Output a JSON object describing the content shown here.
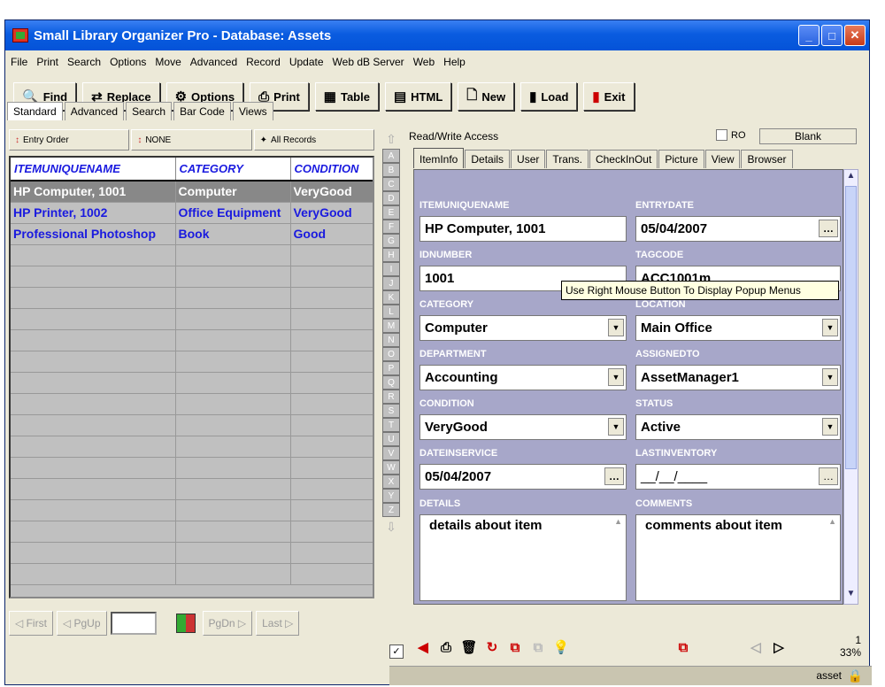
{
  "window": {
    "title": "Small Library Organizer Pro - Database: Assets"
  },
  "menu": [
    "File",
    "Print",
    "Search",
    "Options",
    "Move",
    "Advanced",
    "Record",
    "Update",
    "Web dB Server",
    "Web",
    "Help"
  ],
  "toolbar": {
    "find": "Find",
    "replace": "Replace",
    "options": "Options",
    "print": "Print",
    "table": "Table",
    "html": "HTML",
    "new": "New",
    "load": "Load",
    "exit": "Exit"
  },
  "mode_tabs": [
    "Standard",
    "Advanced",
    "Search",
    "Bar Code",
    "Views"
  ],
  "left_header": {
    "order": "Entry Order",
    "filter": "NONE",
    "records": "All Records"
  },
  "grid": {
    "columns": [
      "ITEMUNIQUENAME",
      "CATEGORY",
      "CONDITION"
    ],
    "rows": [
      [
        "HP Computer, 1001",
        "Computer",
        "VeryGood"
      ],
      [
        "HP Printer, 1002",
        "Office Equipment",
        "VeryGood"
      ],
      [
        "Professional Photoshop",
        "Book",
        "Good"
      ]
    ]
  },
  "left_footer": {
    "first": "First",
    "pgup": "PgUp",
    "pgdn": "PgDn",
    "last": "Last"
  },
  "alphabet": [
    "A",
    "B",
    "C",
    "D",
    "E",
    "F",
    "G",
    "H",
    "I",
    "J",
    "K",
    "L",
    "M",
    "N",
    "O",
    "P",
    "Q",
    "R",
    "S",
    "T",
    "U",
    "V",
    "W",
    "X",
    "Y",
    "Z"
  ],
  "right": {
    "access": "Read/Write Access",
    "ro": "RO",
    "blank": "Blank",
    "tabs": [
      "ItemInfo",
      "Details",
      "User",
      "Trans.",
      "CheckInOut",
      "Picture",
      "View",
      "Browser"
    ]
  },
  "fields": {
    "itemuniquename": {
      "label": "ITEMUNIQUENAME",
      "value": "HP Computer, 1001"
    },
    "entrydate": {
      "label": "ENTRYDATE",
      "value": "05/04/2007"
    },
    "idnumber": {
      "label": "IDNUMBER",
      "value": "1001"
    },
    "tagcode": {
      "label": "TAGCODE",
      "value": "ACC1001m"
    },
    "category": {
      "label": "CATEGORY",
      "value": "Computer"
    },
    "location": {
      "label": "LOCATION",
      "value": "Main Office"
    },
    "department": {
      "label": "DEPARTMENT",
      "value": "Accounting"
    },
    "assignedto": {
      "label": "ASSIGNEDTO",
      "value": "AssetManager1"
    },
    "condition": {
      "label": "CONDITION",
      "value": "VeryGood"
    },
    "status": {
      "label": "STATUS",
      "value": "Active"
    },
    "dateinservice": {
      "label": "DATEINSERVICE",
      "value": "05/04/2007"
    },
    "lastinventory": {
      "label": "LASTINVENTORY",
      "value": "__/__/____"
    },
    "details": {
      "label": "DETAILS",
      "value": "details about item"
    },
    "comments": {
      "label": "COMMENTS",
      "value": "comments about item"
    }
  },
  "tooltip": "Use Right Mouse Button To Display Popup Menus",
  "counter": {
    "record": "1",
    "percent": "33%"
  },
  "status": {
    "text": "asset"
  },
  "colors": {
    "title_bar": "#0a5ce0",
    "form_bg": "#a7a7c9",
    "grid_text": "#1a1adf"
  }
}
